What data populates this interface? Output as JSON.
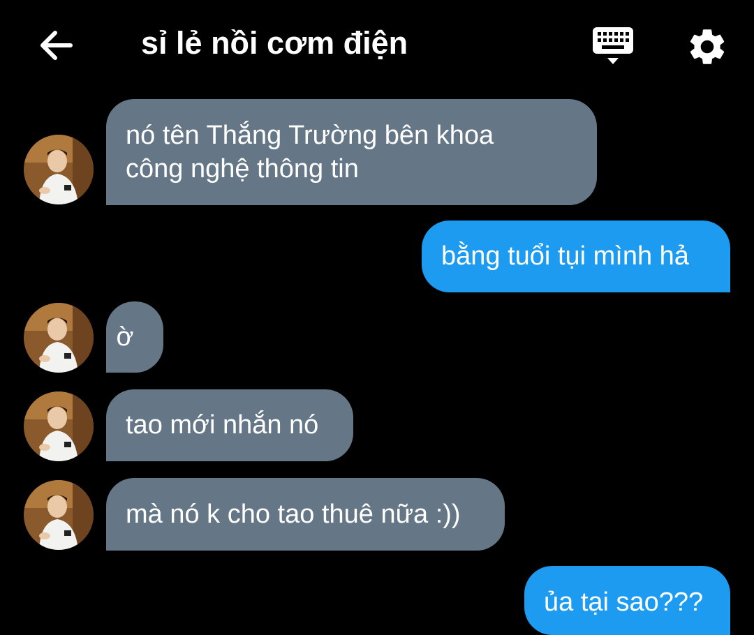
{
  "header": {
    "title": "sỉ lẻ nồi cơm điện",
    "back_icon": "arrow-left-icon",
    "keyboard_icon": "keyboard-icon",
    "settings_icon": "gear-icon"
  },
  "colors": {
    "background": "#000000",
    "incoming_bubble": "#657786",
    "outgoing_bubble": "#1d9bf0",
    "text": "#ffffff"
  },
  "messages": [
    {
      "direction": "incoming",
      "lines": [
        "nó tên Thắng Trường bên khoa",
        "công nghệ thông tin"
      ]
    },
    {
      "direction": "outgoing",
      "lines": [
        "bằng tuổi tụi mình hả"
      ]
    },
    {
      "direction": "incoming",
      "lines": [
        "ờ"
      ]
    },
    {
      "direction": "incoming",
      "lines": [
        "tao mới nhắn nó"
      ]
    },
    {
      "direction": "incoming",
      "lines": [
        "mà nó k cho tao thuê nữa :))"
      ]
    },
    {
      "direction": "outgoing",
      "lines": [
        "ủa tại sao???"
      ]
    }
  ]
}
